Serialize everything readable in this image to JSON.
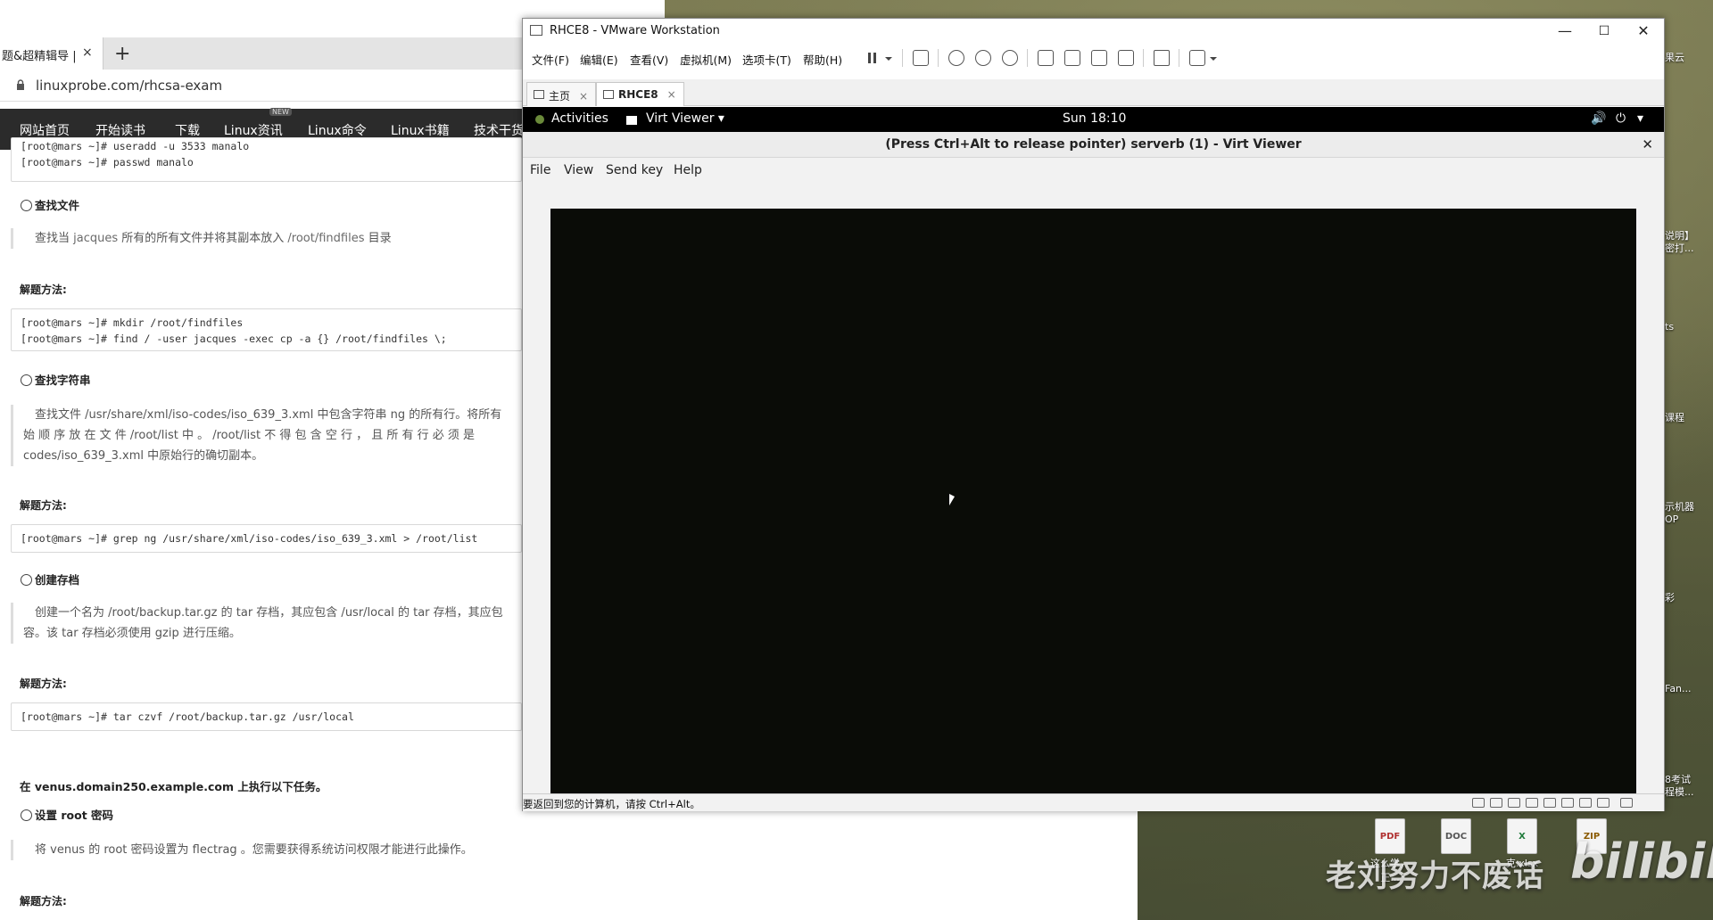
{
  "browser": {
    "tab_title": "题&超精辑导 |",
    "tab_close": "×",
    "new_tab": "+",
    "url": "linuxprobe.com/rhcsa-exam",
    "nav": [
      "网站首页",
      "开始读书",
      "下载",
      "Linux资讯",
      "Linux命令",
      "Linux书籍",
      "技术干货"
    ],
    "nav_badge": "NEW"
  },
  "content": {
    "code1": "[root@mars ~]# useradd -u 3533 manalo\n[root@mars ~]# passwd manalo",
    "sec1_title": "查找文件",
    "sec1_desc_a": "查找当 ",
    "sec1_desc_user": "jacques",
    "sec1_desc_b": " 所有的所有文件并将其副本放入 ",
    "sec1_desc_path": "/root/findfiles",
    "sec1_desc_c": " 目录",
    "method_label": "解题方法:",
    "code2": "[root@mars ~]# mkdir /root/findfiles\n[root@mars ~]# find / -user jacques -exec cp -a {} /root/findfiles \\;",
    "sec2_title": "查找字符串",
    "sec2_line1": "查找文件 /usr/share/xml/iso-codes/iso_639_3.xml 中包含字符串 ng 的所有行。将所有",
    "sec2_line2": "始 顺 序 放 在 文 件  /root/list  中 。  /root/list  不 得 包 含 空 行 ， 且 所 有 行 必 须 是",
    "sec2_line3": "codes/iso_639_3.xml 中原始行的确切副本。",
    "code3": "[root@mars ~]# grep ng /usr/share/xml/iso-codes/iso_639_3.xml > /root/list",
    "sec3_title": "创建存档",
    "sec3_line1": "创建一个名为 /root/backup.tar.gz 的 tar 存档，其应包含 /usr/local 的 tar 存档，其应包",
    "sec3_line2": "容。该 tar 存档必须使用 gzip 进行压缩。",
    "code4": "[root@mars ~]# tar czvf /root/backup.tar.gz /usr/local",
    "venus_line": "在 venus.domain250.example.com 上执行以下任务。",
    "sec4_title": "设置 root 密码",
    "sec4_line1": "将 venus 的 root 密码设置为 flectrag 。您需要获得系统访问权限才能进行此操作。"
  },
  "vmware": {
    "title": "RHCE8 - VMware Workstation",
    "win_minimize": "—",
    "win_maximize": "☐",
    "win_close": "✕",
    "menus": [
      "文件(F)",
      "编辑(E)",
      "查看(V)",
      "虚拟机(M)",
      "选项卡(T)",
      "帮助(H)"
    ],
    "tabs": [
      {
        "label": "主页",
        "close": "×"
      },
      {
        "label": "RHCE8",
        "close": "×"
      }
    ],
    "status_text": "要返回到您的计算机，请按 Ctrl+Alt。"
  },
  "gnome": {
    "activities": "Activities",
    "app": "Virt Viewer ▾",
    "clock": "Sun 18:10",
    "volume": "🔊",
    "power": "⏻",
    "menu_arrow": "▾"
  },
  "virt_viewer": {
    "title": "(Press Ctrl+Alt to release pointer) serverb (1) - Virt Viewer",
    "close": "✕",
    "menus": [
      "File",
      "View",
      "Send key",
      "Help"
    ]
  },
  "desktop": {
    "side_labels": [
      "果云",
      "说明】\n密打...",
      "ts",
      "课程",
      "示机器\nOP",
      "彩",
      "Fan...",
      "8考试\n程模..."
    ],
    "file_icons": [
      {
        "label": "这么学，正...",
        "glyph": "PDF"
      },
      {
        "label": "",
        "glyph": "DOC"
      },
      {
        "label": "克.xlsx",
        "glyph": "X"
      },
      {
        "label": "",
        "glyph": "ZIP"
      }
    ],
    "watermark": "老刘努力不废话",
    "brand": "bilibili"
  },
  "colors": {
    "nav_bg": "#2b2b2b",
    "vm_screen": "#0a0c07",
    "gnome_bar": "#000000"
  }
}
